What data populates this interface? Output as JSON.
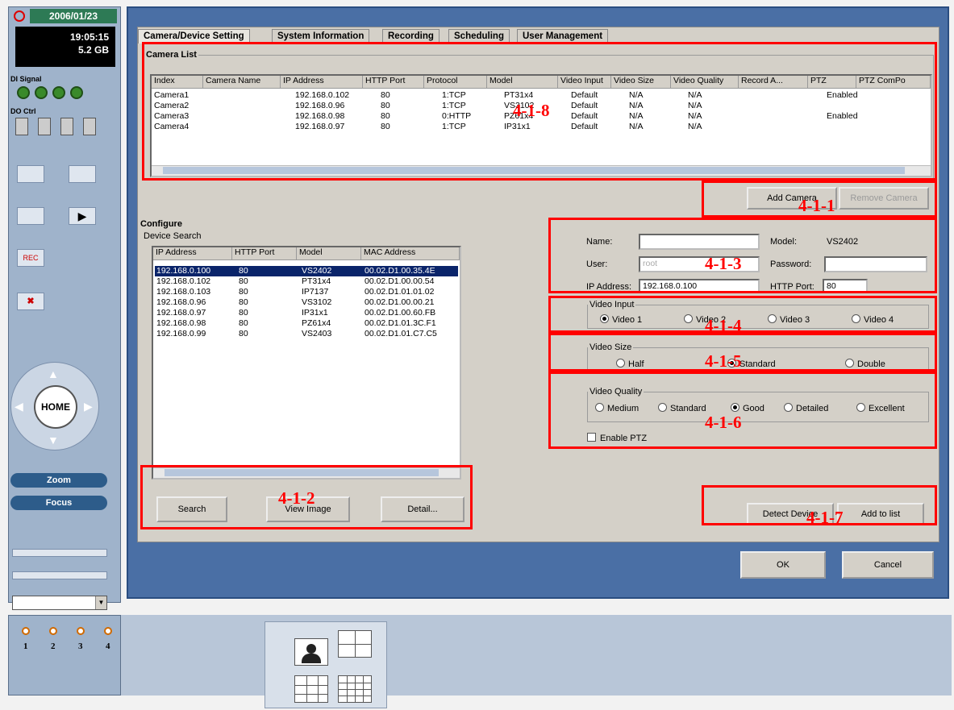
{
  "status": {
    "date": "2006/01/23",
    "time": "19:05:15",
    "disk": "5.2 GB"
  },
  "left_panel": {
    "di_label": "DI Signal",
    "do_label": "DO Ctrl",
    "zoom_label": "Zoom",
    "focus_label": "Focus",
    "home_label": "HOME",
    "channels": [
      "1",
      "2",
      "3",
      "4"
    ]
  },
  "tabs": [
    "Camera/Device Setting",
    "System Information",
    "Recording",
    "Scheduling",
    "User Management"
  ],
  "camera_list": {
    "title": "Camera List",
    "columns": [
      "Index",
      "Camera Name",
      "IP Address",
      "HTTP Port",
      "Protocol",
      "Model",
      "Video Input",
      "Video Size",
      "Video Quality",
      "Record A...",
      "PTZ",
      "PTZ ComPo"
    ],
    "rows": [
      [
        "Camera1",
        "",
        "192.168.0.102",
        "80",
        "1:TCP",
        "PT31x4",
        "Default",
        "N/A",
        "N/A",
        "",
        "Enabled",
        ""
      ],
      [
        "Camera2",
        "",
        "192.168.0.96",
        "80",
        "1:TCP",
        "VS3102",
        "Default",
        "N/A",
        "N/A",
        "",
        "",
        ""
      ],
      [
        "Camera3",
        "",
        "192.168.0.98",
        "80",
        "0:HTTP",
        "PZ61x4",
        "Default",
        "N/A",
        "N/A",
        "",
        "Enabled",
        ""
      ],
      [
        "Camera4",
        "",
        "192.168.0.97",
        "80",
        "1:TCP",
        "IP31x1",
        "Default",
        "N/A",
        "N/A",
        "",
        "",
        ""
      ]
    ],
    "add_camera": "Add Camera",
    "remove_camera": "Remove Camera"
  },
  "configure": {
    "title": "Configure",
    "device_search": {
      "title": "Device Search",
      "columns": [
        "IP Address",
        "HTTP Port",
        "Model",
        "MAC Address"
      ],
      "rows": [
        [
          "192.168.0.100",
          "80",
          "VS2402",
          "00.02.D1.00.35.4E"
        ],
        [
          "192.168.0.102",
          "80",
          "PT31x4",
          "00.02.D1.00.00.54"
        ],
        [
          "192.168.0.103",
          "80",
          "IP7137",
          "00.02.D1.01.01.02"
        ],
        [
          "192.168.0.96",
          "80",
          "VS3102",
          "00.02.D1.00.00.21"
        ],
        [
          "192.168.0.97",
          "80",
          "IP31x1",
          "00.02.D1.00.60.FB"
        ],
        [
          "192.168.0.98",
          "80",
          "PZ61x4",
          "00.02.D1.01.3C.F1"
        ],
        [
          "192.168.0.99",
          "80",
          "VS2403",
          "00.02.D1.01.C7.C5"
        ]
      ],
      "search": "Search",
      "view_image": "View Image",
      "detail": "Detail..."
    },
    "form": {
      "name_label": "Name:",
      "name_value": "",
      "model_label": "Model:",
      "model_value": "VS2402",
      "user_label": "User:",
      "user_placeholder": "root",
      "password_label": "Password:",
      "password_value": "",
      "ip_label": "IP Address:",
      "ip_value": "192.168.0.100",
      "port_label": "HTTP Port:",
      "port_value": "80"
    },
    "video_input": {
      "title": "Video Input",
      "options": [
        "Video 1",
        "Video 2",
        "Video 3",
        "Video 4"
      ],
      "selected": "Video 1"
    },
    "video_size": {
      "title": "Video Size",
      "options": [
        "Half",
        "Standard",
        "Double"
      ],
      "selected": "Standard"
    },
    "video_quality": {
      "title": "Video Quality",
      "options": [
        "Medium",
        "Standard",
        "Good",
        "Detailed",
        "Excellent"
      ],
      "selected": "Good"
    },
    "enable_ptz": "Enable PTZ",
    "detect_device": "Detect Device",
    "add_to_list": "Add to list"
  },
  "footer": {
    "ok": "OK",
    "cancel": "Cancel"
  },
  "callouts": {
    "c418": "4-1-8",
    "c411": "4-1-1",
    "c413": "4-1-3",
    "c414": "4-1-4",
    "c415": "4-1-5",
    "c416": "4-1-6",
    "c412": "4-1-2",
    "c417": "4-1-7"
  },
  "colors": {
    "callout": "#ff0000",
    "selection": "#0a246a",
    "frame": "#4a6fa5"
  }
}
